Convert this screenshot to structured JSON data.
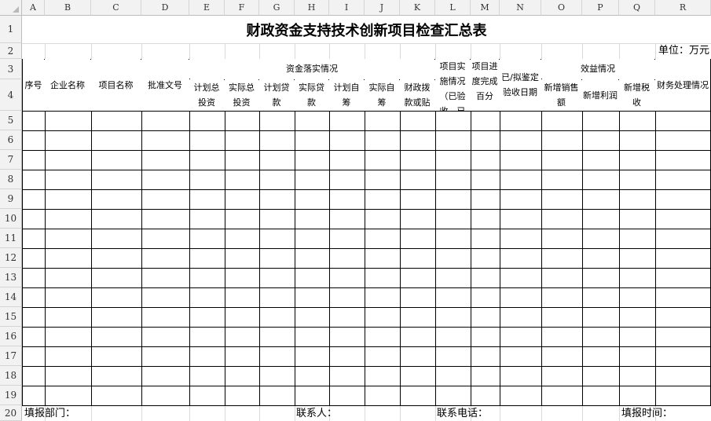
{
  "app": {
    "sheet": "财政资金支持技术创新项目检查汇总表"
  },
  "grid": {
    "columns": [
      "A",
      "B",
      "C",
      "D",
      "E",
      "F",
      "G",
      "H",
      "I",
      "J",
      "K",
      "L",
      "M",
      "N",
      "O",
      "P",
      "Q",
      "R"
    ],
    "rows": [
      "1",
      "2",
      "3",
      "4",
      "5",
      "6",
      "7",
      "8",
      "9",
      "10",
      "11",
      "12",
      "13",
      "14",
      "15",
      "16",
      "17",
      "18",
      "19",
      "20"
    ]
  },
  "title": "财政资金支持技术创新项目检查汇总表",
  "unit": "单位：万元",
  "headers": {
    "seq": "序号",
    "company": "企业名称",
    "project": "项目名称",
    "approval": "批准文号",
    "funding_group": "资金落实情况",
    "plan_invest": "计划总投资",
    "actual_invest": "实际总投资",
    "plan_loan": "计划贷款",
    "actual_loan": "实际贷款",
    "plan_self": "计划自筹",
    "actual_self": "实际自筹",
    "subsidy": "财政拨款或贴",
    "impl": "项目实施情况（已验收、已",
    "progress": "项目进度完成百分",
    "accept_date": "已/拟鉴定验收日期",
    "benefit_group": "效益情况",
    "new_sales": "新增销售额",
    "new_profit": "新增利润",
    "new_tax": "新增税收",
    "finance": "财务处理情况"
  },
  "footer": {
    "dept": "填报部门：",
    "contact": "联系人：",
    "phone": "联系电话：",
    "time": "填报时间："
  }
}
